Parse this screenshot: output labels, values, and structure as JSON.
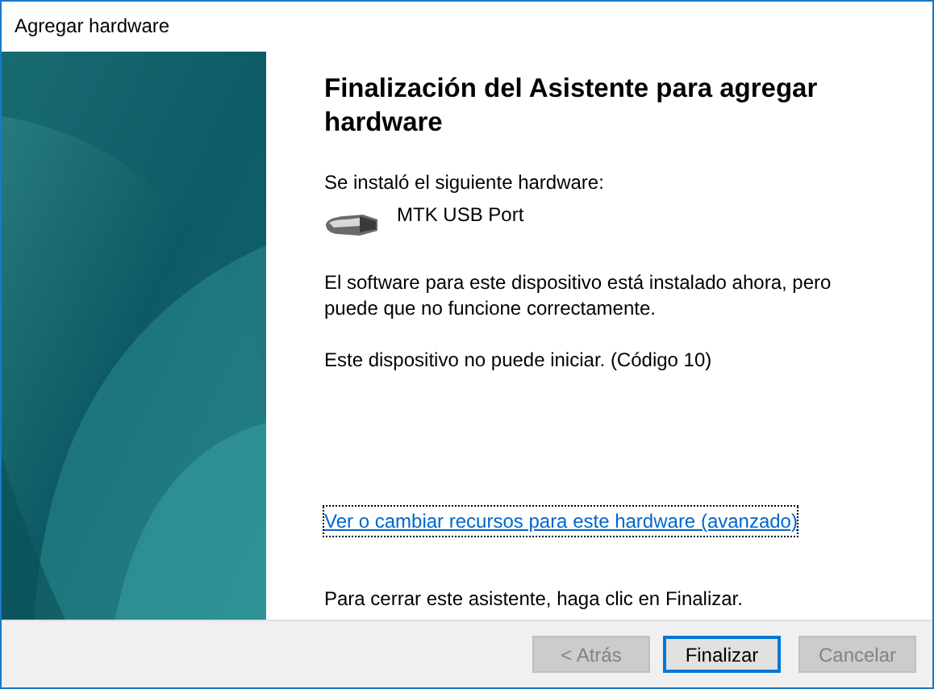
{
  "window": {
    "title": "Agregar hardware"
  },
  "heading": "Finalización del Asistente para agregar hardware",
  "installed_label": "Se instaló el siguiente hardware:",
  "device": {
    "name": "MTK USB Port"
  },
  "status_text": "El software para este dispositivo está instalado ahora, pero puede que no funcione correctamente.",
  "error_text": "Este dispositivo no puede iniciar. (Código 10)",
  "link": "Ver o cambiar recursos para este hardware (avanzado)",
  "closing_text": "Para cerrar este asistente, haga clic en Finalizar.",
  "buttons": [
    {
      "label": "< Atrás",
      "disabled": true,
      "focused": false
    },
    {
      "label": "Finalizar",
      "disabled": false,
      "focused": true
    },
    {
      "label": "Cancelar",
      "disabled": true,
      "focused": false
    }
  ]
}
